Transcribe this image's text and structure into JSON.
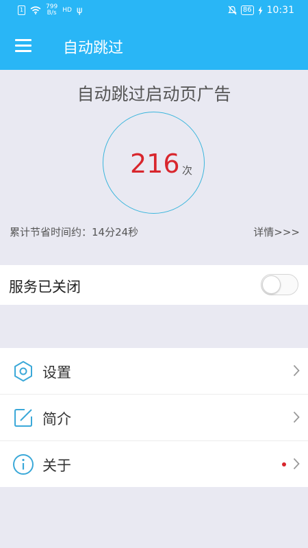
{
  "status_bar": {
    "sim_label": "1",
    "net_speed_value": "799",
    "net_speed_unit": "B/s",
    "network_type": "HD",
    "usb_glyph": "ψ",
    "battery_level": "86",
    "time": "10:31",
    "icons": [
      "sim-icon",
      "wifi-icon",
      "usb-icon",
      "mute-icon",
      "battery-icon",
      "charging-icon"
    ]
  },
  "app_bar": {
    "title": "自动跳过"
  },
  "hero": {
    "title": "自动跳过启动页广告",
    "count": "216",
    "count_unit": "次",
    "time_saved": "累计节省时间约：14分24秒",
    "details_link": "详情>>>"
  },
  "service": {
    "label": "服务已关闭",
    "enabled": false
  },
  "menu": {
    "items": [
      {
        "label": "设置",
        "icon": "hexagon-settings-icon"
      },
      {
        "label": "简介",
        "icon": "edit-square-icon"
      },
      {
        "label": "关于",
        "icon": "info-circle-icon",
        "has_badge": true
      }
    ]
  },
  "colors": {
    "primary": "#29b6f6",
    "accent_red": "#d8262d",
    "ring": "#39b5dc",
    "background": "#e9e9f2",
    "icon": "#3aa8d8"
  }
}
